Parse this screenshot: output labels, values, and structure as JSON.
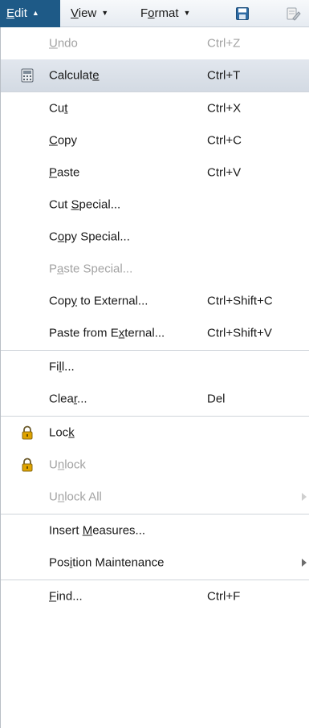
{
  "menubar": {
    "edit": {
      "label_underlined": "E",
      "label_rest": "dit",
      "caret": "▲"
    },
    "view": {
      "label_underlined": "V",
      "label_rest": "iew",
      "caret": "▼"
    },
    "format": {
      "label_pre": "F",
      "label_underlined": "o",
      "label_rest": "rmat",
      "caret": "▼"
    },
    "icons": [
      "save-icon",
      "document-edit-icon"
    ]
  },
  "menu": {
    "undo": {
      "pre": "",
      "u": "U",
      "post": "ndo",
      "shortcut": "Ctrl+Z"
    },
    "calculate": {
      "pre": "Calculat",
      "u": "e",
      "post": "",
      "shortcut": "Ctrl+T",
      "icon": "calculator-icon"
    },
    "cut": {
      "pre": "Cu",
      "u": "t",
      "post": "",
      "shortcut": "Ctrl+X"
    },
    "copy": {
      "pre": "",
      "u": "C",
      "post": "opy",
      "shortcut": "Ctrl+C"
    },
    "paste": {
      "pre": "",
      "u": "P",
      "post": "aste",
      "shortcut": "Ctrl+V"
    },
    "cut_special": {
      "pre": "Cut ",
      "u": "S",
      "post": "pecial..."
    },
    "copy_special": {
      "pre": "C",
      "u": "o",
      "post": "py Special..."
    },
    "paste_special": {
      "pre": "P",
      "u": "a",
      "post": "ste Special..."
    },
    "copy_external": {
      "pre": "Cop",
      "u": "y",
      "post": " to External...",
      "shortcut": "Ctrl+Shift+C"
    },
    "paste_external": {
      "pre": "Paste from E",
      "u": "x",
      "post": "ternal...",
      "shortcut": "Ctrl+Shift+V"
    },
    "fill": {
      "pre": "Fi",
      "u": "l",
      "post": "l..."
    },
    "clear": {
      "pre": "Clea",
      "u": "r",
      "post": "...",
      "shortcut": "Del"
    },
    "lock": {
      "pre": "Loc",
      "u": "k",
      "post": "",
      "icon": "lock-icon"
    },
    "unlock": {
      "pre": "U",
      "u": "n",
      "post": "lock",
      "icon": "lock-icon"
    },
    "unlock_all": {
      "pre": "U",
      "u": "n",
      "post": "lock All"
    },
    "insert_measures": {
      "pre": "Insert ",
      "u": "M",
      "post": "easures..."
    },
    "position_maintenance": {
      "pre": "Pos",
      "u": "i",
      "post": "tion Maintenance"
    },
    "find": {
      "pre": "",
      "u": "F",
      "post": "ind...",
      "shortcut": "Ctrl+F"
    }
  },
  "colors": {
    "menubar_active": "#1e5a87",
    "highlight": "#d9dfe7",
    "disabled_text": "#a3a3a3",
    "lock_gold": "#e0a400"
  }
}
